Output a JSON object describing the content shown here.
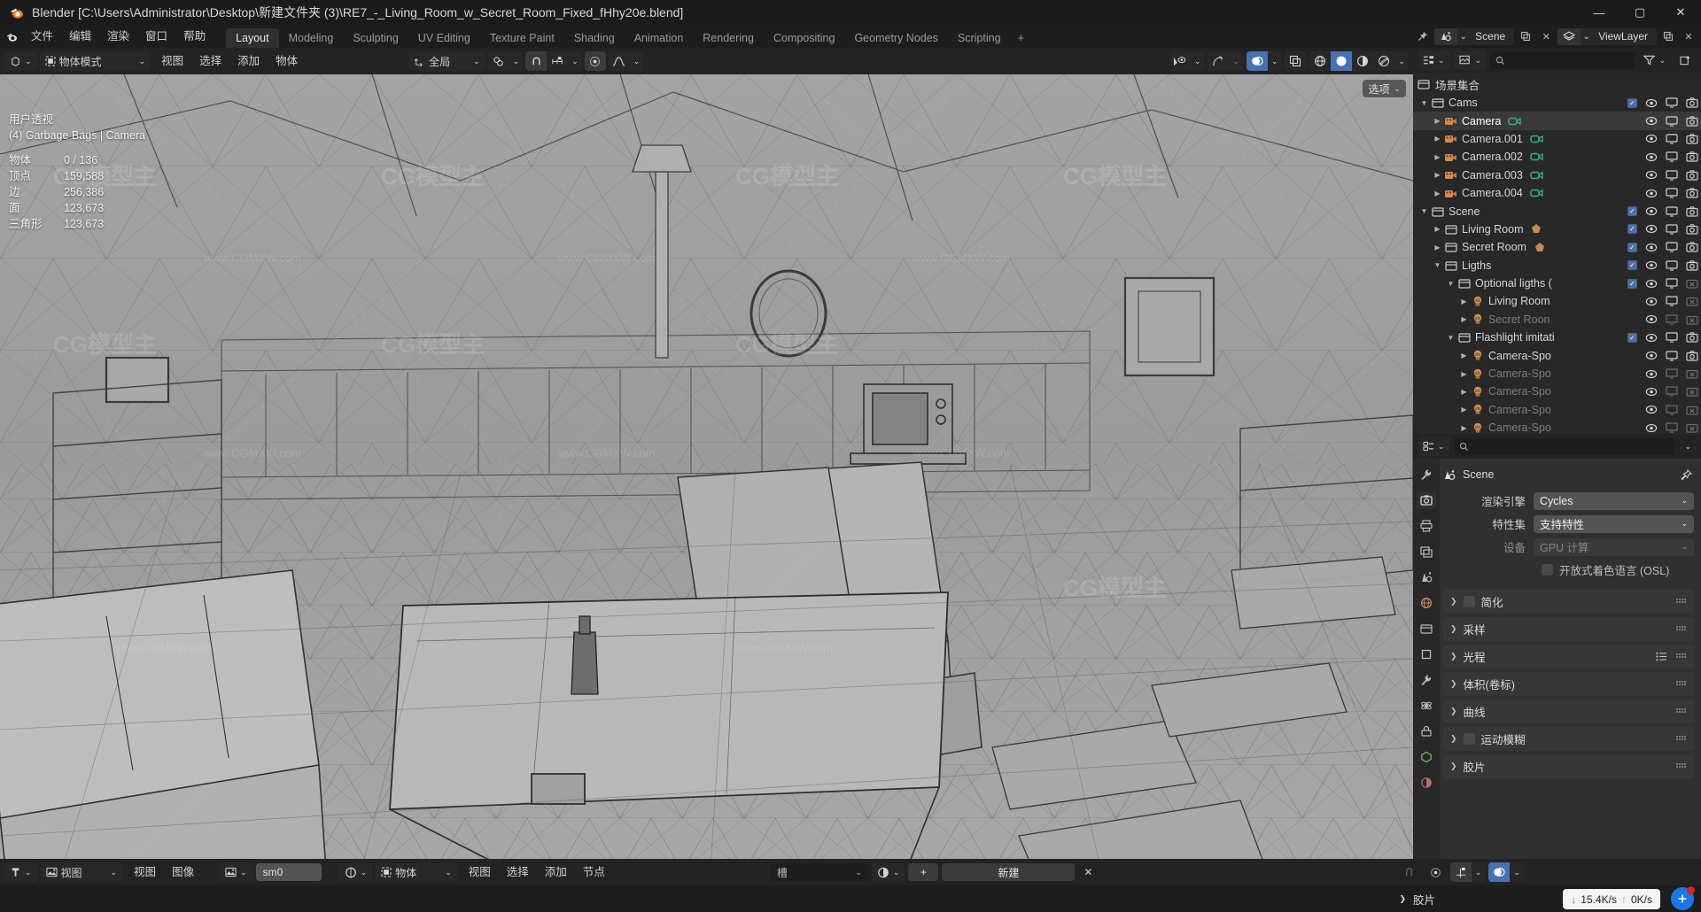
{
  "window": {
    "title": "Blender [C:\\Users\\Administrator\\Desktop\\新建文件夹 (3)\\RE7_-_Living_Room_w_Secret_Room_Fixed_fHhy20e.blend]",
    "app_icon": "blender-logo-icon",
    "minimize": "—",
    "maximize": "▢",
    "close": "✕"
  },
  "topbar": {
    "logo": "blender-logo-icon",
    "menus": [
      "文件",
      "编辑",
      "渲染",
      "窗口",
      "帮助"
    ],
    "workspaces": [
      {
        "label": "Layout",
        "active": true
      },
      {
        "label": "Modeling",
        "active": false
      },
      {
        "label": "Sculpting",
        "active": false
      },
      {
        "label": "UV Editing",
        "active": false
      },
      {
        "label": "Texture Paint",
        "active": false
      },
      {
        "label": "Shading",
        "active": false
      },
      {
        "label": "Animation",
        "active": false
      },
      {
        "label": "Rendering",
        "active": false
      },
      {
        "label": "Compositing",
        "active": false
      },
      {
        "label": "Geometry Nodes",
        "active": false
      },
      {
        "label": "Scripting",
        "active": false
      }
    ],
    "add_workspace": "+",
    "scene_name": "Scene",
    "view_layer_name": "ViewLayer",
    "scene_icon": "scene-data-icon",
    "viewlayer_icon": "view-layer-icon",
    "pin_icon": "pin-icon",
    "copy_icon": "duplicate-icon",
    "new_icon": "new-icon",
    "remove_icon": "x-icon"
  },
  "viewport": {
    "header": {
      "editor_type_icon": "editor-type-3dview-icon",
      "mode": "物体模式",
      "mode_icon": "object-mode-icon",
      "menus": [
        "视图",
        "选择",
        "添加",
        "物体"
      ],
      "transform_orientation": "全局",
      "orientation_icon": "orientation-axis-icon",
      "snap_icon": "magnet-icon",
      "snap_target_icon": "snap-increment-icon",
      "pivot_icon": "pivot-median-icon",
      "proportional_icon": "proportional-edit-icon",
      "visibility_icon": "object-visibility-icon",
      "gizmo_icon": "gizmo-icon",
      "overlay_icon": "overlays-icon",
      "xray_icon": "xray-toggle-icon",
      "shading_modes": [
        "wireframe",
        "solid",
        "material",
        "rendered"
      ],
      "shading_active": "solid"
    },
    "options_label": "选项",
    "stats": {
      "view_name": "用户透视",
      "active_object": "(4) Garbage Bags | Camera",
      "rows": [
        {
          "key": "物体",
          "value": "0 / 136"
        },
        {
          "key": "顶点",
          "value": "159,588"
        },
        {
          "key": "边",
          "value": "256,386"
        },
        {
          "key": "面",
          "value": "123,673"
        },
        {
          "key": "三角形",
          "value": "123,673"
        }
      ]
    },
    "watermark_big": "CG模型主",
    "watermark_small": "www.CGMXW.com"
  },
  "outliner": {
    "display_mode_icon": "outliner-display-mode-icon",
    "filter_icon": "filter-icon",
    "new_collection_icon": "new-collection-icon",
    "search_placeholder": "",
    "search_icon": "search-icon",
    "root": {
      "label": "场景集合",
      "icon": "collection-icon"
    },
    "rows": [
      {
        "indent": 0,
        "tri": "▼",
        "icon": "collection-icon",
        "label": "Cams",
        "checkbox": true,
        "eye": true,
        "screen": true,
        "camera": true,
        "dim": false,
        "sub_icon": null,
        "selected": false
      },
      {
        "indent": 1,
        "tri": "▶",
        "icon": "camera-object-icon",
        "label": "Camera",
        "checkbox": false,
        "eye": true,
        "screen": true,
        "camera": true,
        "dim": false,
        "sub_icon": "camera-data-icon",
        "selected": true
      },
      {
        "indent": 1,
        "tri": "▶",
        "icon": "camera-object-icon",
        "label": "Camera.001",
        "checkbox": false,
        "eye": true,
        "screen": true,
        "camera": true,
        "dim": false,
        "sub_icon": "camera-data-icon",
        "selected": false
      },
      {
        "indent": 1,
        "tri": "▶",
        "icon": "camera-object-icon",
        "label": "Camera.002",
        "checkbox": false,
        "eye": true,
        "screen": true,
        "camera": true,
        "dim": false,
        "sub_icon": "camera-data-icon",
        "selected": false
      },
      {
        "indent": 1,
        "tri": "▶",
        "icon": "camera-object-icon",
        "label": "Camera.003",
        "checkbox": false,
        "eye": true,
        "screen": true,
        "camera": true,
        "dim": false,
        "sub_icon": "camera-data-icon",
        "selected": false
      },
      {
        "indent": 1,
        "tri": "▶",
        "icon": "camera-object-icon",
        "label": "Camera.004",
        "checkbox": false,
        "eye": true,
        "screen": true,
        "camera": true,
        "dim": false,
        "sub_icon": "camera-data-icon",
        "selected": false
      },
      {
        "indent": 0,
        "tri": "▼",
        "icon": "collection-icon",
        "label": "Scene",
        "checkbox": true,
        "eye": true,
        "screen": true,
        "camera": true,
        "dim": false,
        "sub_icon": null,
        "selected": false
      },
      {
        "indent": 1,
        "tri": "▶",
        "icon": "collection-icon",
        "label": "Living Room",
        "checkbox": true,
        "eye": true,
        "screen": true,
        "camera": true,
        "dim": false,
        "sub_icon": "mesh-count-icon",
        "selected": false
      },
      {
        "indent": 1,
        "tri": "▶",
        "icon": "collection-icon",
        "label": "Secret Room",
        "checkbox": true,
        "eye": true,
        "screen": true,
        "camera": true,
        "dim": false,
        "sub_icon": "mesh-count-icon",
        "selected": false
      },
      {
        "indent": 1,
        "tri": "▼",
        "icon": "collection-icon",
        "label": "Ligths",
        "checkbox": true,
        "eye": true,
        "screen": true,
        "camera": true,
        "dim": false,
        "sub_icon": null,
        "selected": false
      },
      {
        "indent": 2,
        "tri": "▼",
        "icon": "collection-icon",
        "label": "Optional ligths (",
        "checkbox": true,
        "eye": true,
        "screen": true,
        "camera": false,
        "dim": false,
        "sub_icon": null,
        "selected": false
      },
      {
        "indent": 3,
        "tri": "▶",
        "icon": "light-object-icon",
        "label": "Living Room",
        "checkbox": false,
        "eye": true,
        "screen": true,
        "camera": false,
        "dim": false,
        "sub_icon": null,
        "selected": false
      },
      {
        "indent": 3,
        "tri": "▶",
        "icon": "light-object-icon",
        "label": "Secret Roon",
        "checkbox": false,
        "eye": true,
        "screen": false,
        "camera": false,
        "dim": true,
        "sub_icon": null,
        "selected": false
      },
      {
        "indent": 2,
        "tri": "▼",
        "icon": "collection-icon",
        "label": "Flashlight imitati",
        "checkbox": true,
        "eye": true,
        "screen": true,
        "camera": true,
        "dim": false,
        "sub_icon": null,
        "selected": false
      },
      {
        "indent": 3,
        "tri": "▶",
        "icon": "light-object-icon",
        "label": "Camera-Spo",
        "checkbox": false,
        "eye": true,
        "screen": true,
        "camera": true,
        "dim": false,
        "sub_icon": null,
        "selected": false
      },
      {
        "indent": 3,
        "tri": "▶",
        "icon": "light-object-icon",
        "label": "Camera-Spo",
        "checkbox": false,
        "eye": true,
        "screen": false,
        "camera": false,
        "dim": true,
        "sub_icon": null,
        "selected": false
      },
      {
        "indent": 3,
        "tri": "▶",
        "icon": "light-object-icon",
        "label": "Camera-Spo",
        "checkbox": false,
        "eye": true,
        "screen": false,
        "camera": false,
        "dim": true,
        "sub_icon": null,
        "selected": false
      },
      {
        "indent": 3,
        "tri": "▶",
        "icon": "light-object-icon",
        "label": "Camera-Spo",
        "checkbox": false,
        "eye": true,
        "screen": false,
        "camera": false,
        "dim": true,
        "sub_icon": null,
        "selected": false
      },
      {
        "indent": 3,
        "tri": "▶",
        "icon": "light-object-icon",
        "label": "Camera-Spo",
        "checkbox": false,
        "eye": true,
        "screen": false,
        "camera": false,
        "dim": true,
        "sub_icon": null,
        "selected": false
      }
    ]
  },
  "properties": {
    "editor_type_icon": "editor-type-properties-icon",
    "search_placeholder": "",
    "search_icon": "search-icon",
    "breadcrumb": "Scene",
    "breadcrumb_icon": "scene-data-icon",
    "pin_icon": "pin-icon",
    "tabs": [
      {
        "name": "tool",
        "icon": "wrench-icon",
        "active": false
      },
      {
        "name": "render",
        "icon": "camera-back-icon",
        "active": true
      },
      {
        "name": "output",
        "icon": "printer-icon",
        "active": false
      },
      {
        "name": "view-layer",
        "icon": "images-icon",
        "active": false
      },
      {
        "name": "scene",
        "icon": "scene-cone-icon",
        "active": false
      },
      {
        "name": "world",
        "icon": "world-icon",
        "active": false
      },
      {
        "name": "collection",
        "icon": "collection-props-icon",
        "active": false
      },
      {
        "name": "object",
        "icon": "object-props-icon",
        "active": false
      },
      {
        "name": "modifiers",
        "icon": "wrench-mod-icon",
        "active": false
      },
      {
        "name": "physics",
        "icon": "physics-icon",
        "active": false
      },
      {
        "name": "constraints",
        "icon": "constraint-icon",
        "active": false
      },
      {
        "name": "data",
        "icon": "data-icon",
        "active": false
      },
      {
        "name": "material",
        "icon": "material-icon",
        "active": false
      }
    ],
    "fields": [
      {
        "label": "渲染引擎",
        "value": "Cycles",
        "disabled": false,
        "chev": true
      },
      {
        "label": "特性集",
        "value": "支持特性",
        "disabled": false,
        "chev": true
      },
      {
        "label": "设备",
        "value": "GPU 计算",
        "disabled": true,
        "chev": true
      }
    ],
    "checkbox_row": {
      "label": "开放式着色语言 (OSL)",
      "checked": false
    },
    "panels": [
      {
        "label": "简化",
        "has_checkbox": true,
        "list_icon": false
      },
      {
        "label": "采样",
        "has_checkbox": false,
        "list_icon": false
      },
      {
        "label": "光程",
        "has_checkbox": false,
        "list_icon": true
      },
      {
        "label": "体积(卷标)",
        "has_checkbox": false,
        "list_icon": false
      },
      {
        "label": "曲线",
        "has_checkbox": false,
        "list_icon": false
      },
      {
        "label": "运动模糊",
        "has_checkbox": true,
        "list_icon": false
      },
      {
        "label": "胶片",
        "has_checkbox": false,
        "list_icon": false
      }
    ]
  },
  "bottom_bar_left": {
    "editor_type_icon": "editor-type-image-icon",
    "view_mode": "视图",
    "mode_icon": "image-editor-icon",
    "menus": [
      "视图",
      "图像"
    ],
    "image_icon": "image-data-icon",
    "image_name": "sm0",
    "browse_icon": "browse-material-icon"
  },
  "bottom_bar_right": {
    "object_icon": "object-mode-icon",
    "object_label": "物体",
    "menus": [
      "视图",
      "选择",
      "添加",
      "节点"
    ],
    "slot_label": "槽",
    "material_icon": "material-sphere-icon",
    "new_label": "新建",
    "plus": "+",
    "x": "✕"
  },
  "status_bar": {
    "panel_label": "胶片",
    "download_speed": "15.4K/s",
    "upload_speed": "0K/s",
    "down_arrow": "↓",
    "up_arrow": "↑",
    "net_icon": "network-speed-icon",
    "snap_icons": [
      "snap-icon",
      "proportional-icon",
      "transform-icon",
      "overlay-icon"
    ]
  }
}
